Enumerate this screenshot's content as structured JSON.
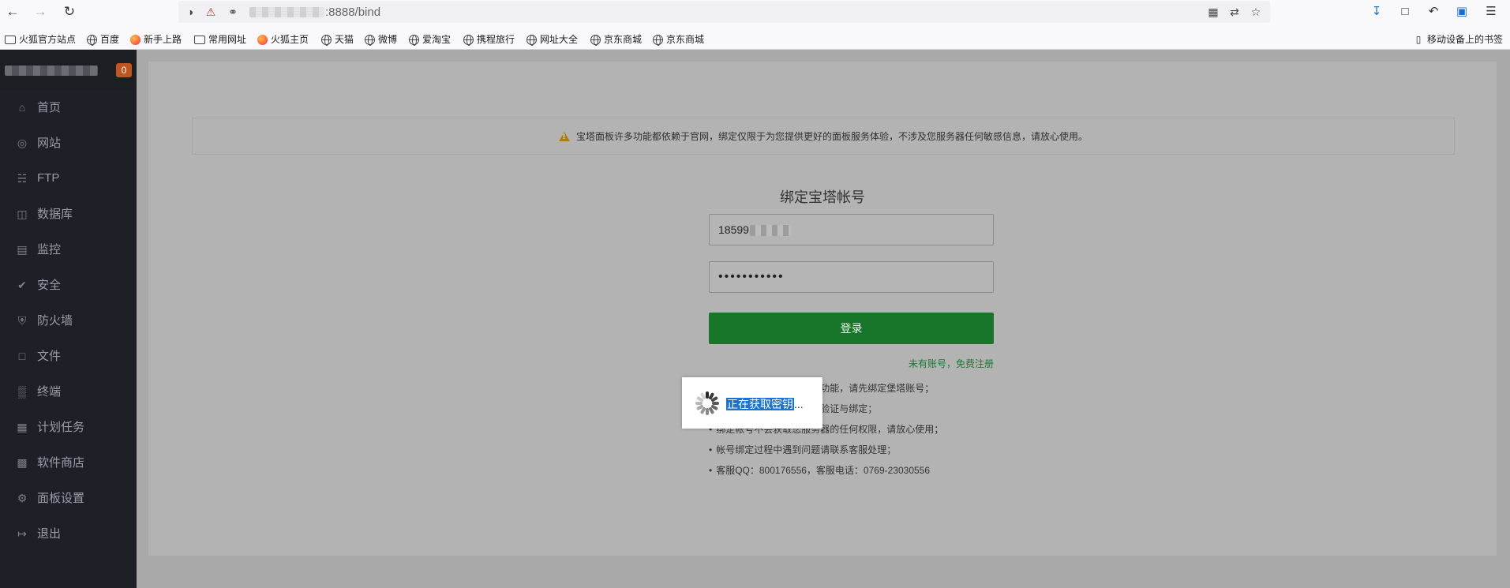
{
  "browser": {
    "url_suffix": ":8888/bind",
    "mobile_bookmarks_label": "移动设备上的书签",
    "bookmarks": [
      {
        "label": "火狐官方站点",
        "icon": "folder-icon"
      },
      {
        "label": "百度",
        "icon": "globe-icon"
      },
      {
        "label": "新手上路",
        "icon": "firefox-icon"
      },
      {
        "label": "常用网址",
        "icon": "folder-icon"
      },
      {
        "label": "火狐主页",
        "icon": "firefox-icon"
      },
      {
        "label": "天猫",
        "icon": "globe-icon"
      },
      {
        "label": "微博",
        "icon": "globe-icon"
      },
      {
        "label": "爱淘宝",
        "icon": "globe-icon"
      },
      {
        "label": "携程旅行",
        "icon": "globe-icon"
      },
      {
        "label": "网址大全",
        "icon": "globe-icon"
      },
      {
        "label": "京东商城",
        "icon": "globe-icon"
      },
      {
        "label": "京东商城",
        "icon": "globe-icon"
      }
    ]
  },
  "sidebar": {
    "badge": "0",
    "items": [
      {
        "label": "首页",
        "icon": "home-icon"
      },
      {
        "label": "网站",
        "icon": "globe-icon"
      },
      {
        "label": "FTP",
        "icon": "ftp-icon"
      },
      {
        "label": "数据库",
        "icon": "database-icon"
      },
      {
        "label": "监控",
        "icon": "monitor-icon"
      },
      {
        "label": "安全",
        "icon": "shield-check-icon"
      },
      {
        "label": "防火墙",
        "icon": "shield-icon"
      },
      {
        "label": "文件",
        "icon": "folder-icon"
      },
      {
        "label": "终端",
        "icon": "terminal-icon"
      },
      {
        "label": "计划任务",
        "icon": "calendar-icon"
      },
      {
        "label": "软件商店",
        "icon": "apps-icon"
      },
      {
        "label": "面板设置",
        "icon": "gear-icon"
      },
      {
        "label": "退出",
        "icon": "logout-icon"
      }
    ]
  },
  "main": {
    "notice": "宝塔面板许多功能都依赖于官网，绑定仅限于为您提供更好的面板服务体验，不涉及您服务器任何敏感信息，请放心使用。",
    "title": "绑定宝塔帐号",
    "username_prefix": "18599",
    "password_mask": "•••••••••••",
    "login_button": "登录",
    "register_link": "未有账号，免费注册",
    "tips": [
      "为了您能更好的体验面板功能，请先绑定堡塔账号；",
      "宝塔账号仅用于面板功能验证与绑定；",
      "绑定帐号不会获取您服务器的任何权限，请放心使用；",
      "帐号绑定过程中遇到问题请联系客服处理；",
      "客服QQ：800176556，客服电话：0769-23030556"
    ],
    "loading_text": "正在获取密钥",
    "loading_suffix": "..."
  },
  "colors": {
    "sidebar_bg": "#1d2026",
    "login_button": "#17762a",
    "badge": "#c0561d",
    "link": "#1c7a31",
    "selection": "#1a73d4"
  }
}
